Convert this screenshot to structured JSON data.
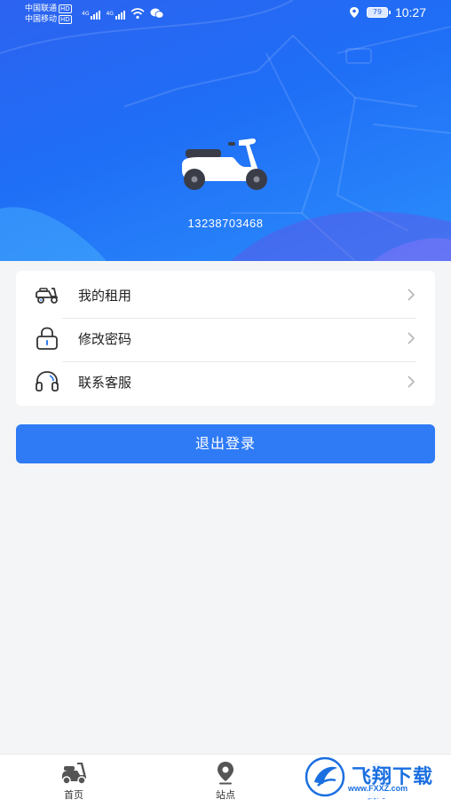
{
  "status_bar": {
    "carrier_1": "中国联通",
    "carrier_2": "中国移动",
    "hd_badge": "HD",
    "network": "4G",
    "battery": "79",
    "time": "10:27"
  },
  "profile": {
    "phone": "13238703468",
    "avatar_icon": "scooter-icon"
  },
  "menu": {
    "items": [
      {
        "label": "我的租用",
        "icon": "scooter-outline-icon"
      },
      {
        "label": "修改密码",
        "icon": "lock-icon"
      },
      {
        "label": "联系客服",
        "icon": "headset-icon"
      }
    ]
  },
  "actions": {
    "logout_label": "退出登录"
  },
  "tabbar": {
    "tabs": [
      {
        "label": "首页",
        "icon": "scooter-icon"
      },
      {
        "label": "站点",
        "icon": "location-pin-icon"
      },
      {
        "label": "我的",
        "icon": "user-icon"
      }
    ]
  },
  "watermark": {
    "brand": "飞翔下载",
    "url": "www.FXXZ.com"
  },
  "colors": {
    "primary": "#2f7bf6",
    "header_gradient_start": "#2c63f0",
    "page_background": "#f4f5f7"
  }
}
